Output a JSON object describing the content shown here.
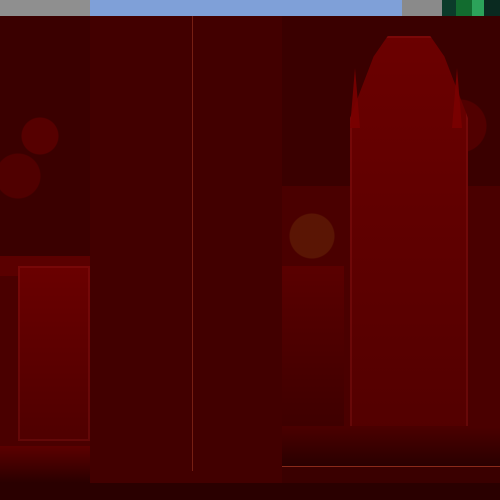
{
  "window": {
    "title": ""
  },
  "panels": {
    "left": {},
    "middle": {},
    "right": {}
  }
}
